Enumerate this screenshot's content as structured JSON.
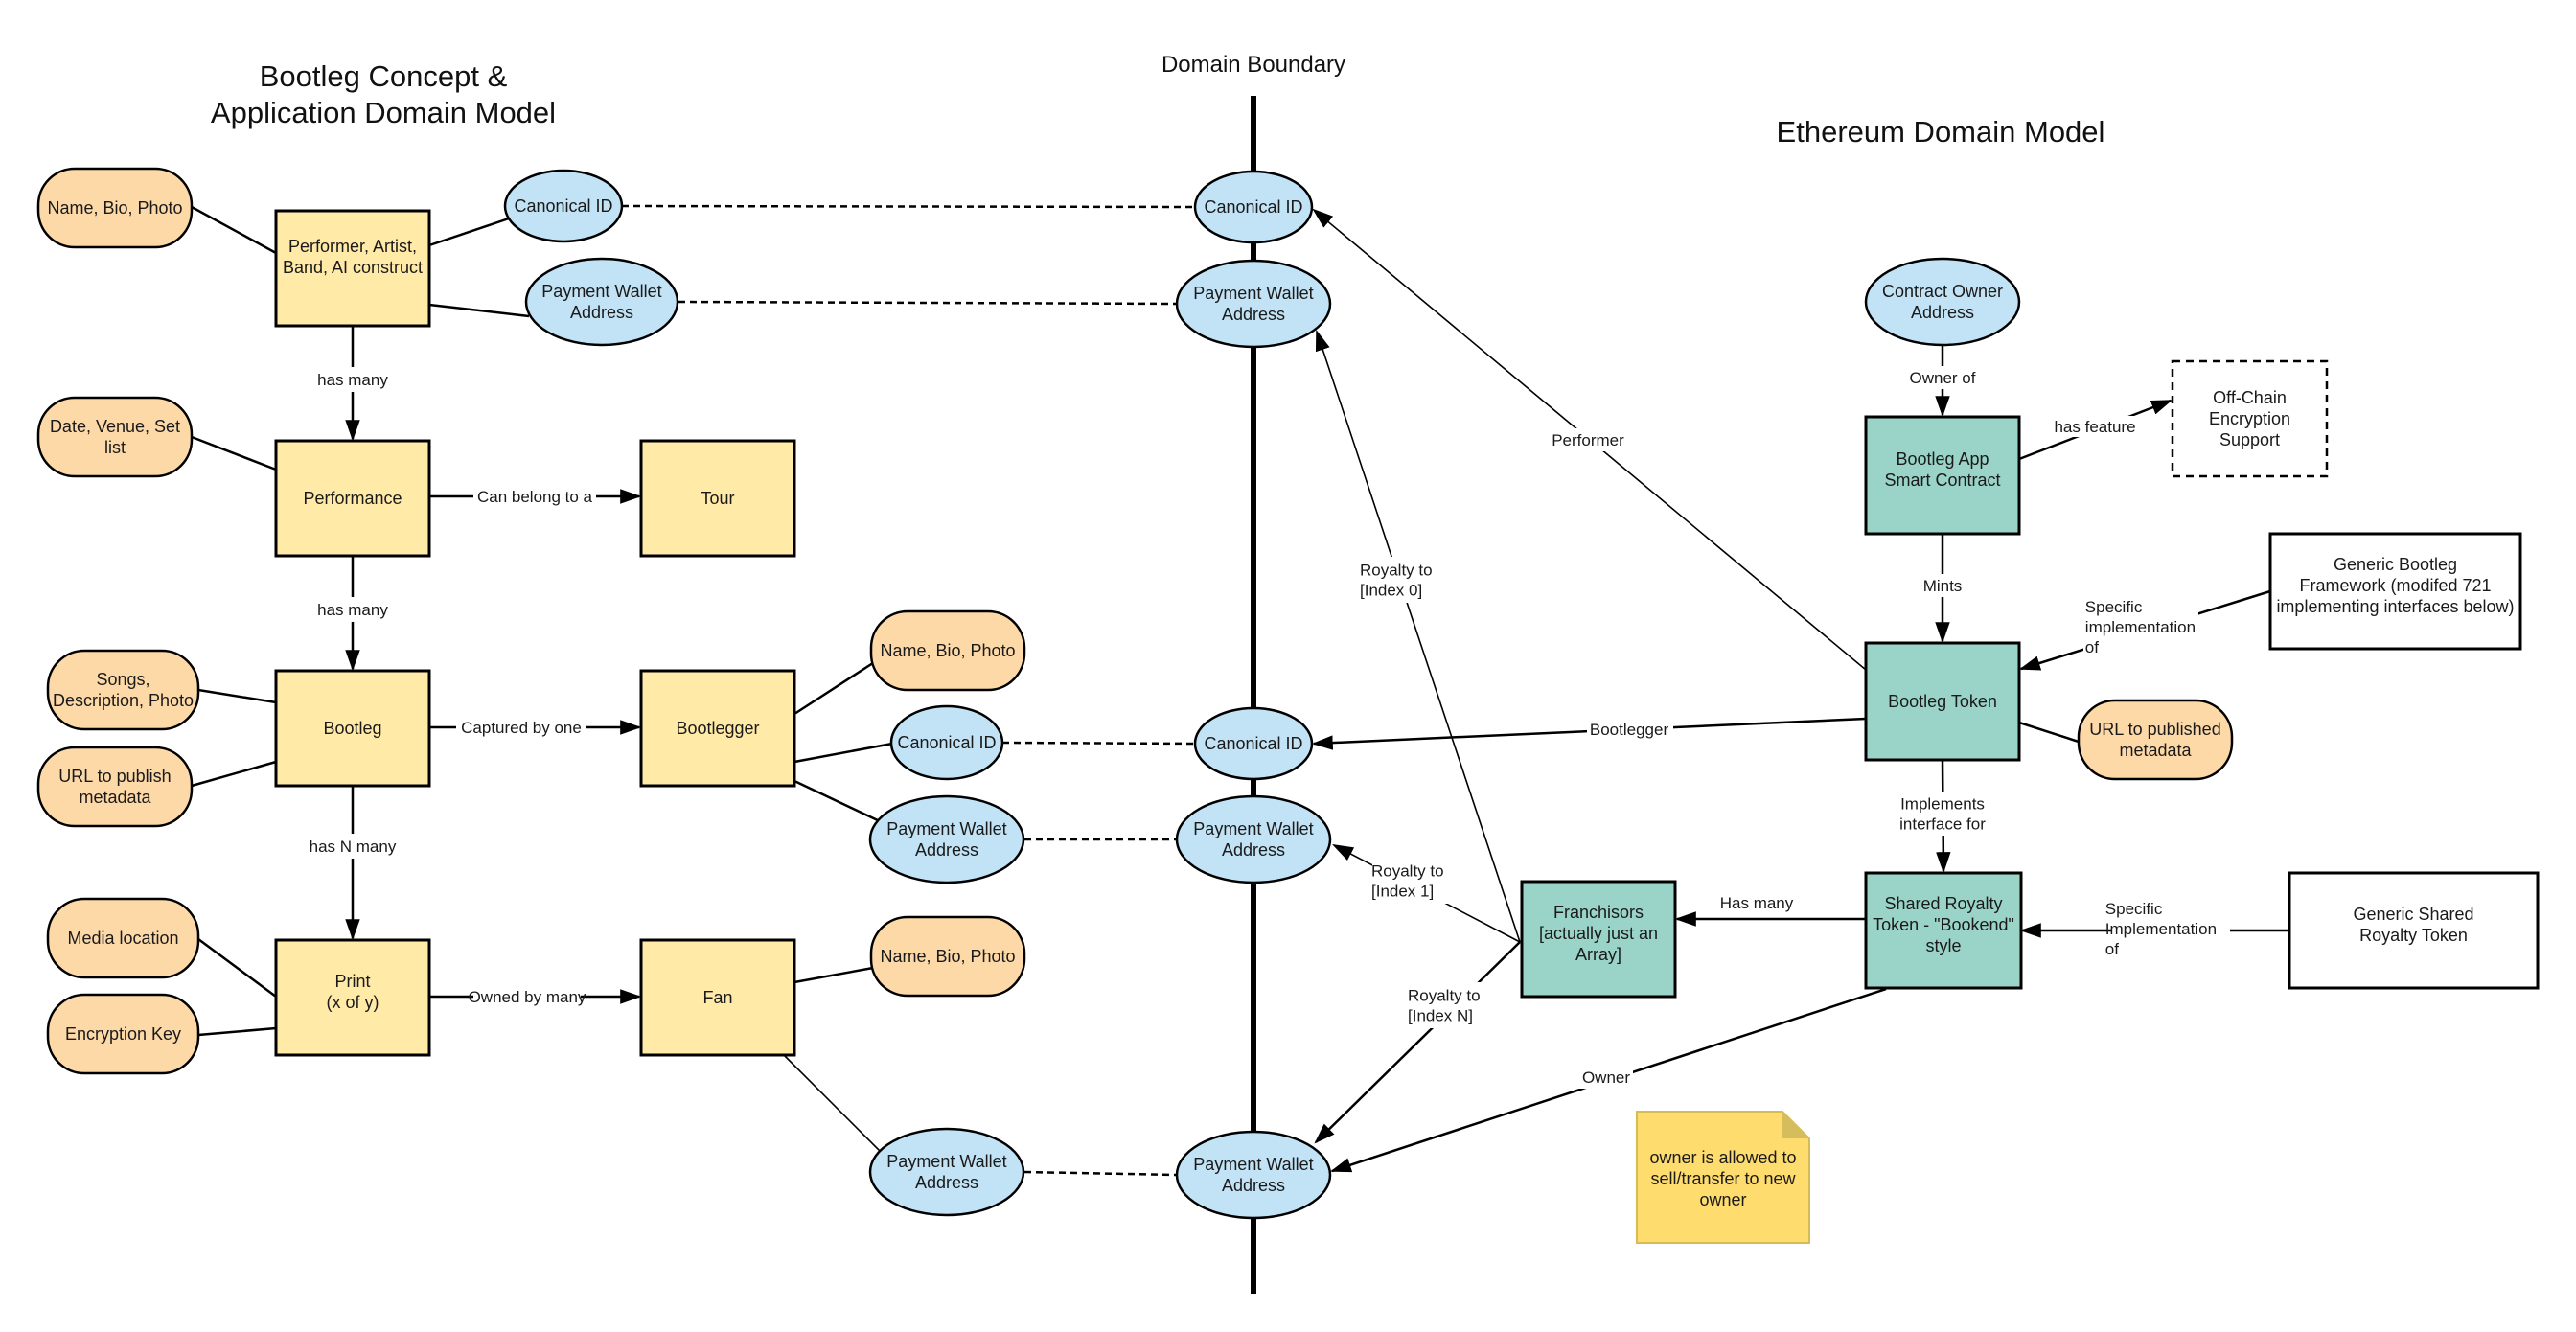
{
  "titles": {
    "left_line1": "Bootleg Concept &",
    "left_line2": "Application Domain Model",
    "boundary": "Domain Boundary",
    "right": "Ethereum Domain Model"
  },
  "nodes": {
    "performer": [
      "Performer, Artist,",
      "Band, AI construct"
    ],
    "performance": [
      "Performance"
    ],
    "tour": [
      "Tour"
    ],
    "bootleg": [
      "Bootleg"
    ],
    "bootlegger": [
      "Bootlegger"
    ],
    "print": [
      "Print",
      "(x of y)"
    ],
    "fan": [
      "Fan"
    ],
    "attr_performer_name": [
      "Name, Bio, Photo"
    ],
    "attr_performance_date": [
      "Date, Venue, Set",
      "list"
    ],
    "attr_bootleg_songs": [
      "Songs,",
      "Description, Photo"
    ],
    "attr_bootleg_url": [
      "URL to publish",
      "metadata"
    ],
    "attr_print_media": [
      "Media location"
    ],
    "attr_print_key": [
      "Encryption Key"
    ],
    "attr_bootlegger_name": [
      "Name, Bio, Photo"
    ],
    "attr_fan_name": [
      "Name, Bio, Photo"
    ],
    "performer_canonical_id": [
      "Canonical ID"
    ],
    "performer_wallet": [
      "Payment Wallet",
      "Address"
    ],
    "bootlegger_canonical_id": [
      "Canonical ID"
    ],
    "bootlegger_wallet": [
      "Payment Wallet",
      "Address"
    ],
    "fan_wallet": [
      "Payment Wallet",
      "Address"
    ],
    "boundary_canonical_id_1": [
      "Canonical ID"
    ],
    "boundary_wallet_1": [
      "Payment Wallet",
      "Address"
    ],
    "boundary_canonical_id_2": [
      "Canonical ID"
    ],
    "boundary_wallet_2": [
      "Payment Wallet",
      "Address"
    ],
    "boundary_wallet_3": [
      "Payment Wallet",
      "Address"
    ],
    "contract_owner": [
      "Contract Owner",
      "Address"
    ],
    "bootleg_app": [
      "Bootleg App",
      "Smart Contract"
    ],
    "offchain": [
      "Off-Chain",
      "Encryption",
      "Support"
    ],
    "generic_bootleg": [
      "Generic Bootleg",
      "Framework (modifed 721",
      "implementing interfaces below)"
    ],
    "bootleg_token": [
      "Bootleg Token"
    ],
    "url_published": [
      "URL to published",
      "metadata"
    ],
    "shared_royalty": [
      "Shared Royalty",
      "Token - \"Bookend\"",
      "style"
    ],
    "generic_shared": [
      "Generic Shared",
      "Royalty Token"
    ],
    "franchisors": [
      "Franchisors",
      "[actually just an",
      "Array]"
    ]
  },
  "edge_labels": {
    "performer_has_many": [
      "has many"
    ],
    "performance_has_many": [
      "has many"
    ],
    "bootleg_has_n_many": [
      "has N many"
    ],
    "can_belong_to": [
      "Can belong to a"
    ],
    "captured_by_one": [
      "Captured by one"
    ],
    "owned_by_many": [
      "Owned by many"
    ],
    "owner_of": [
      "Owner of"
    ],
    "has_feature": [
      "has feature"
    ],
    "mints": [
      "Mints"
    ],
    "specific_impl_1": [
      "Specific",
      "implementation",
      "of"
    ],
    "implements_interface": [
      "Implements",
      "interface for"
    ],
    "specific_impl_2": [
      "Specific",
      "Implementation",
      "of"
    ],
    "performer_edge": [
      "Performer"
    ],
    "bootlegger_edge": [
      "Bootlegger"
    ],
    "royalty_0": [
      "Royalty to",
      "[Index 0]"
    ],
    "royalty_1": [
      "Royalty to",
      "[Index 1]"
    ],
    "royalty_n": [
      "Royalty to",
      "[Index N]"
    ],
    "has_many_franchisors": [
      "Has many"
    ],
    "owner_edge": [
      "Owner"
    ]
  },
  "note": [
    "owner is allowed to",
    "sell/transfer to new",
    "owner"
  ],
  "colors": {
    "app_entity": "#ffeaa7",
    "attribute": "#fdd9a8",
    "identifier": "#c2e3f6",
    "ethereum_entity": "#9ad4c8",
    "note": "#ffdc6e"
  }
}
